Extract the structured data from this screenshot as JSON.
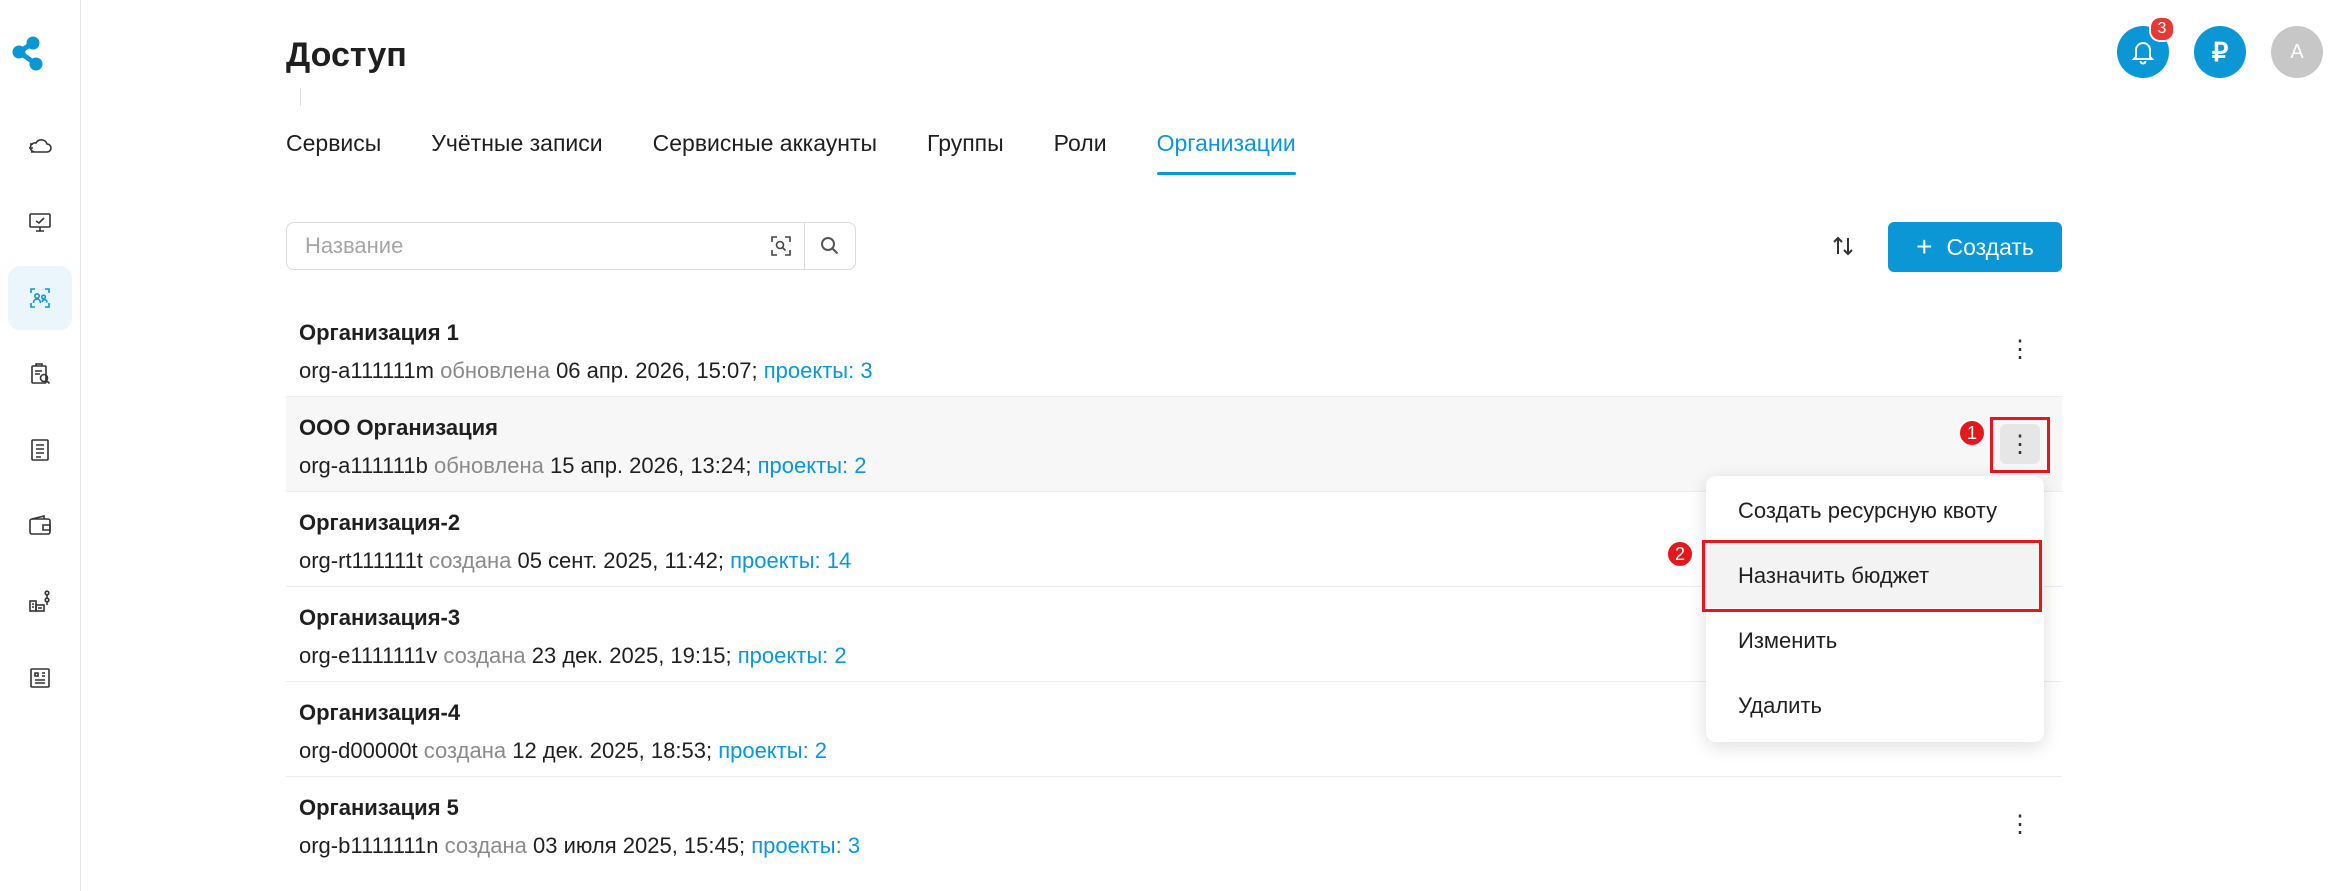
{
  "header": {
    "title": "Доступ"
  },
  "top_actions": {
    "notifications_count": "3",
    "billing_icon_glyph": "₽",
    "avatar_initial": "A"
  },
  "tabs": [
    {
      "label": "Сервисы",
      "active": false
    },
    {
      "label": "Учётные записи",
      "active": false
    },
    {
      "label": "Сервисные аккаунты",
      "active": false
    },
    {
      "label": "Группы",
      "active": false
    },
    {
      "label": "Роли",
      "active": false
    },
    {
      "label": "Организации",
      "active": true
    }
  ],
  "search": {
    "placeholder": "Название",
    "value": ""
  },
  "toolbar": {
    "create_label": "Создать",
    "create_icon": "+"
  },
  "organizations": [
    {
      "name": "Организация 1",
      "id": "org-a111111m",
      "status": "обновлена",
      "date": "06 апр. 2026, 15:07",
      "sep": ";",
      "projects": "проекты: 3"
    },
    {
      "name": "ООО Организация",
      "id": "org-a111111b",
      "status": "обновлена",
      "date": "15 апр. 2026, 13:24",
      "sep": ";",
      "projects": "проекты: 2"
    },
    {
      "name": "Организация-2",
      "id": "org-rt111111t",
      "status": "создана",
      "date": "05 сент. 2025, 11:42",
      "sep": ";",
      "projects": "проекты: 14"
    },
    {
      "name": "Организация-3",
      "id": "org-e1111111v",
      "status": "создана",
      "date": "23 дек. 2025, 19:15",
      "sep": ";",
      "projects": "проекты: 2"
    },
    {
      "name": "Организация-4",
      "id": "org-d00000t",
      "status": "создана",
      "date": "12 дек. 2025, 18:53",
      "sep": ";",
      "projects": "проекты: 2"
    },
    {
      "name": "Организация 5",
      "id": "org-b1111111n",
      "status": "создана",
      "date": "03 июля 2025, 15:45",
      "sep": ";",
      "projects": "проекты: 3"
    }
  ],
  "context_menu": {
    "items": [
      "Создать ресурсную квоту",
      "Назначить бюджет",
      "Изменить",
      "Удалить"
    ]
  },
  "annotations": {
    "step1": "1",
    "step2": "2"
  },
  "colors": {
    "accent": "#0b96d5",
    "highlight": "#e3181f"
  },
  "sidebar": {
    "icons": [
      "cloud-icon",
      "monitor-icon",
      "access-icon",
      "clipboard-icon",
      "list-icon",
      "wallet-icon",
      "structure-icon",
      "building-icon"
    ]
  }
}
